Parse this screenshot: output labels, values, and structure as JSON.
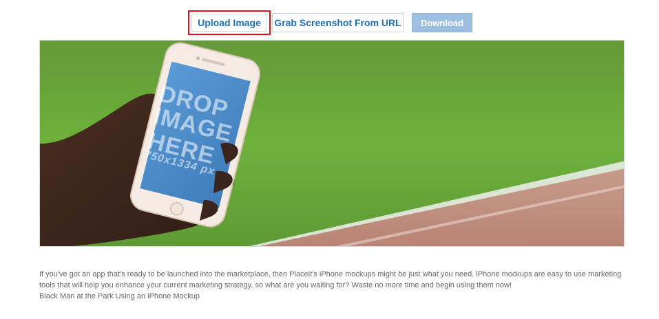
{
  "toolbar": {
    "upload_label": "Upload Image",
    "grab_label": "Grab Screenshot From URL",
    "download_label": "Download"
  },
  "mockup": {
    "drop_line1": "DROP",
    "drop_line2": "IMAGE",
    "drop_line3": "HERE",
    "size_label": "750x1334 px"
  },
  "content": {
    "description": "If you've got an app that's ready to be launched into the marketplace, then Placeit's iPhone mockups might be just what you need. iPhone mockups are easy to use marketing tools that will help you enhance your current marketing strategy, so what are you waiting for? Waste no more time and begin using them now!",
    "image_title": "Black Man at the Park Using an iPhone Mockup"
  },
  "colors": {
    "accent_blue": "#1f6fb5",
    "highlight_red": "#e0111b",
    "download_bg": "#9dc0e2"
  }
}
